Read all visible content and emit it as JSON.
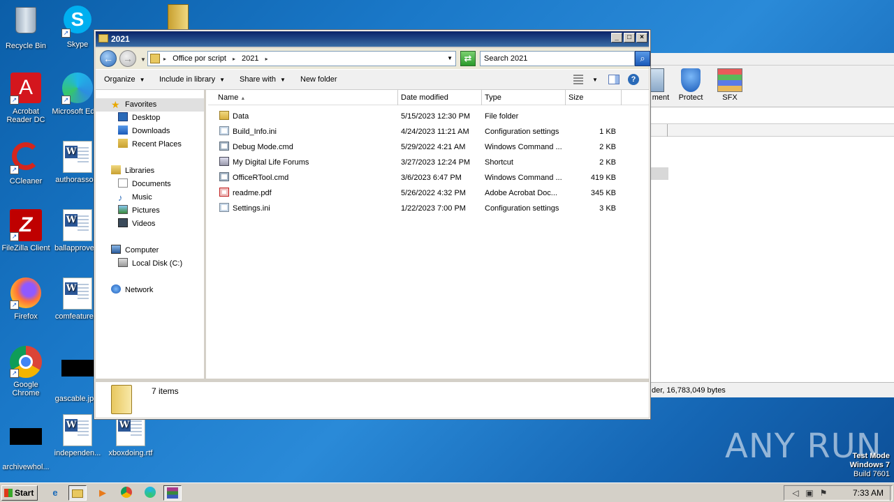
{
  "desktop": {
    "icons": [
      {
        "label": "Recycle Bin"
      },
      {
        "label": "Skype"
      },
      {
        "label": "Acrobat Reader DC"
      },
      {
        "label": "Microsoft Edge"
      },
      {
        "label": "CCleaner"
      },
      {
        "label": "authorasso..."
      },
      {
        "label": "FileZilla Client"
      },
      {
        "label": "ballapprove..."
      },
      {
        "label": "Firefox"
      },
      {
        "label": "comfeature..."
      },
      {
        "label": "Google Chrome"
      },
      {
        "label": "gascable.jp..."
      },
      {
        "label": "archivewhol..."
      },
      {
        "label": "independen..."
      },
      {
        "label": "xboxdoing.rtf"
      }
    ]
  },
  "background_window": {
    "toolbar": [
      {
        "label": "ment"
      },
      {
        "label": "Protect"
      },
      {
        "label": "SFX"
      }
    ],
    "status": "der, 16,783,049 bytes"
  },
  "explorer": {
    "title": "2021",
    "address": {
      "crumbs": [
        "Office por script",
        "2021"
      ]
    },
    "search_placeholder": "Search 2021",
    "commands": {
      "organize": "Organize",
      "include": "Include in library",
      "share": "Share with",
      "new_folder": "New folder"
    },
    "nav": {
      "favorites": "Favorites",
      "desktop": "Desktop",
      "downloads": "Downloads",
      "recent": "Recent Places",
      "libraries": "Libraries",
      "documents": "Documents",
      "music": "Music",
      "pictures": "Pictures",
      "videos": "Videos",
      "computer": "Computer",
      "local_disk": "Local Disk (C:)",
      "network": "Network"
    },
    "columns": {
      "name": "Name",
      "date": "Date modified",
      "type": "Type",
      "size": "Size"
    },
    "files": [
      {
        "name": "Data",
        "date": "5/15/2023 12:30 PM",
        "type": "File folder",
        "size": "",
        "icon": "folder-icon"
      },
      {
        "name": "Build_Info.ini",
        "date": "4/24/2023 11:21 AM",
        "type": "Configuration settings",
        "size": "1 KB",
        "icon": "ini-icon"
      },
      {
        "name": "Debug Mode.cmd",
        "date": "5/29/2022 4:21 AM",
        "type": "Windows Command ...",
        "size": "2 KB",
        "icon": "cmd-icon"
      },
      {
        "name": "My Digital Life Forums",
        "date": "3/27/2023 12:24 PM",
        "type": "Shortcut",
        "size": "2 KB",
        "icon": "shortcut-icon"
      },
      {
        "name": "OfficeRTool.cmd",
        "date": "3/6/2023 6:47 PM",
        "type": "Windows Command ...",
        "size": "419 KB",
        "icon": "cmd-icon"
      },
      {
        "name": "readme.pdf",
        "date": "5/26/2022 4:32 PM",
        "type": "Adobe Acrobat Doc...",
        "size": "345 KB",
        "icon": "pdf-icon"
      },
      {
        "name": "Settings.ini",
        "date": "1/22/2023 7:00 PM",
        "type": "Configuration settings",
        "size": "3 KB",
        "icon": "ini-icon"
      }
    ],
    "details": {
      "count": "7 items"
    }
  },
  "taskbar": {
    "start": "Start",
    "clock": "7:33 AM"
  },
  "watermark": {
    "line1": "Test Mode",
    "line2": "Windows 7",
    "line3": "Build 7601",
    "brand": "ANY RUN"
  }
}
